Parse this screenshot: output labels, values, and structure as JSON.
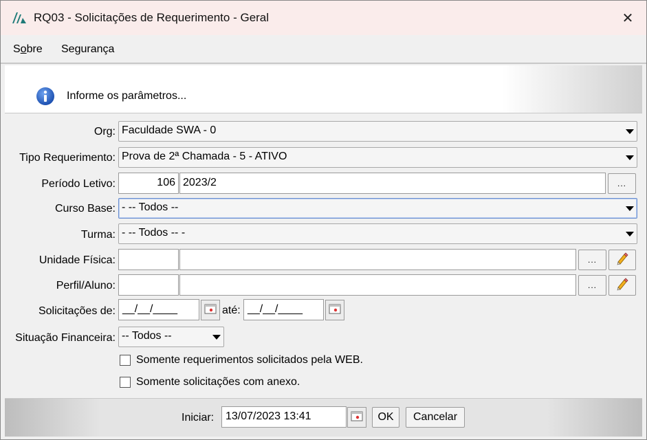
{
  "window": {
    "title": "RQ03 - Solicitações de Requerimento - Geral",
    "close_glyph": "✕"
  },
  "menu": {
    "items": [
      {
        "label": "Sobre",
        "mnemonic_index": 1
      },
      {
        "label": "Segurança"
      }
    ]
  },
  "banner": {
    "message": "Informe os parâmetros...",
    "icon": "info-icon"
  },
  "form": {
    "org": {
      "label": "Org:",
      "value": "Faculdade SWA - 0"
    },
    "tipo_requerimento": {
      "label": "Tipo Requerimento:",
      "value": "Prova de 2ª Chamada - 5 - ATIVO"
    },
    "periodo_letivo": {
      "label": "Período Letivo:",
      "code": "106",
      "description": "2023/2",
      "lookup_label": "..."
    },
    "curso_base": {
      "label": "Curso Base:",
      "value": "- -- Todos --"
    },
    "turma": {
      "label": "Turma:",
      "value": "- -- Todos -- -"
    },
    "unidade_fisica": {
      "label": "Unidade Física:",
      "code": "",
      "description": "",
      "lookup_label": "..."
    },
    "perfil_aluno": {
      "label": "Perfil/Aluno:",
      "code": "",
      "description": "",
      "lookup_label": "..."
    },
    "solicitacoes": {
      "label": "Solicitações de:",
      "from_value": "__/__/____",
      "to_label": "até:",
      "to_value": "__/__/____"
    },
    "situacao_financeira": {
      "label": "Situação Financeira:",
      "value": "-- Todos --"
    },
    "checkbox_web": {
      "label": "Somente requerimentos solicitados pela WEB.",
      "checked": false
    },
    "checkbox_anexo": {
      "label": "Somente solicitações com anexo.",
      "checked": false
    }
  },
  "footer": {
    "iniciar_label": "Iniciar:",
    "iniciar_value": "13/07/2023 13:41",
    "ok_label": "OK",
    "cancel_label": "Cancelar"
  },
  "colors": {
    "title_bar": "#faeceb",
    "info_blue": "#2a62c4",
    "focus_border": "#6a8fd0"
  }
}
